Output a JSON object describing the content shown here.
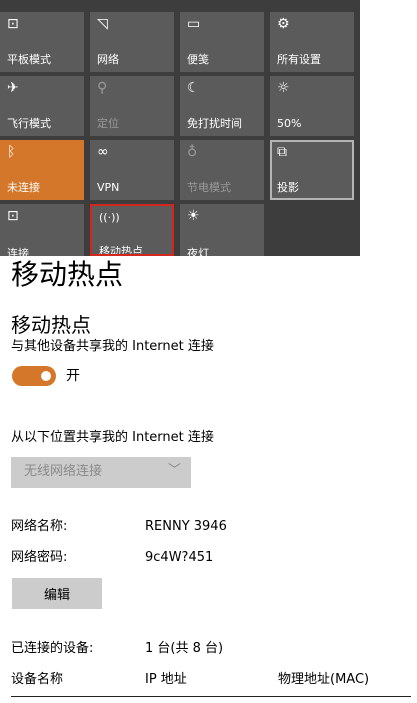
{
  "quick_actions": {
    "tiles": [
      {
        "label": "平板模式",
        "icon": "tablet-mode-icon",
        "glyph": "⊡",
        "state": "normal"
      },
      {
        "label": "网络",
        "icon": "network-icon",
        "glyph": "◹",
        "state": "normal"
      },
      {
        "label": "便笺",
        "icon": "note-icon",
        "glyph": "▭",
        "state": "normal"
      },
      {
        "label": "所有设置",
        "icon": "gear-icon",
        "glyph": "⚙",
        "state": "normal"
      },
      {
        "label": "飞行模式",
        "icon": "airplane-icon",
        "glyph": "✈",
        "state": "normal"
      },
      {
        "label": "定位",
        "icon": "location-icon",
        "glyph": "⚲",
        "state": "disabled"
      },
      {
        "label": "免打扰时间",
        "icon": "moon-icon",
        "glyph": "☾",
        "state": "normal"
      },
      {
        "label": "50%",
        "icon": "brightness-icon",
        "glyph": "☼",
        "state": "normal"
      },
      {
        "label": "未连接",
        "icon": "bluetooth-icon",
        "glyph": "ᛒ",
        "state": "active"
      },
      {
        "label": "VPN",
        "icon": "vpn-icon",
        "glyph": "∞",
        "state": "normal"
      },
      {
        "label": "节电模式",
        "icon": "battery-saver-icon",
        "glyph": "♁",
        "state": "disabled"
      },
      {
        "label": "投影",
        "icon": "project-icon",
        "glyph": "⧉",
        "state": "selected"
      },
      {
        "label": "连接",
        "icon": "connect-icon",
        "glyph": "⊡",
        "state": "normal"
      },
      {
        "label": "移动热点",
        "icon": "mobile-hotspot-icon",
        "glyph": "((·))",
        "state": "highlighted"
      },
      {
        "label": "夜灯",
        "icon": "night-light-icon",
        "glyph": "☀",
        "state": "normal"
      }
    ]
  },
  "settings": {
    "page_title": "移动热点",
    "section_title": "移动热点",
    "description": "与其他设备共享我的 Internet 连接",
    "toggle": {
      "label": "开",
      "state": "on"
    },
    "share_from_label": "从以下位置共享我的 Internet 连接",
    "share_from_select": {
      "value": "无线网络连接",
      "chevron": "﹀"
    },
    "network_name_label": "网络名称:",
    "network_name_value": "RENNY 3946",
    "network_password_label": "网络密码:",
    "network_password_value": "9c4W?451",
    "edit_button_label": "编辑",
    "connected_devices_label": "已连接的设备:",
    "connected_devices_value": "1 台(共 8 台)",
    "table_headers": [
      "设备名称",
      "IP 地址",
      "物理地址(MAC)"
    ]
  },
  "colors": {
    "accent": "#d4772a",
    "tile_bg": "#5b5b5b",
    "highlight_border": "#d1271d"
  }
}
